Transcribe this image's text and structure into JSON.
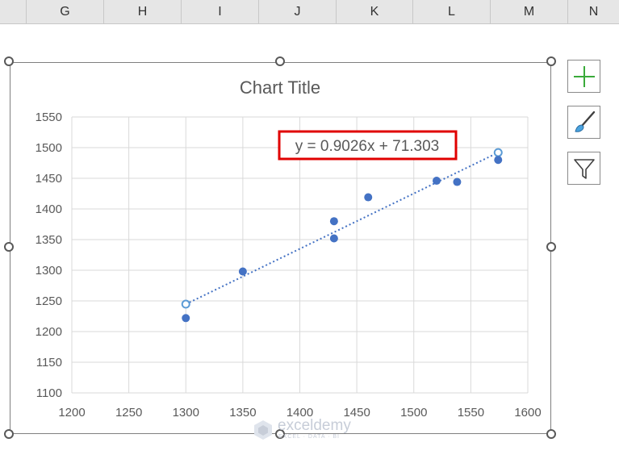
{
  "columns": [
    {
      "label": "G"
    },
    {
      "label": "H"
    },
    {
      "label": "I"
    },
    {
      "label": "J"
    },
    {
      "label": "K"
    },
    {
      "label": "L"
    },
    {
      "label": "M"
    },
    {
      "label": "N"
    }
  ],
  "chart_buttons": {
    "elements": "chart-elements-plus-icon",
    "styles": "chart-styles-brush-icon",
    "filters": "chart-filters-funnel-icon"
  },
  "watermark": {
    "name": "exceldemy",
    "tagline": "EXCEL · DATA · BI"
  },
  "colors": {
    "marker": "#4472c4",
    "trendline": "#4472c4",
    "trend_open_marker": "#5b9bd5",
    "grid": "#d9d9d9",
    "equation_border": "#e00000",
    "plus_icon": "#3aaa3a"
  },
  "chart_data": {
    "type": "scatter",
    "title": "Chart Title",
    "xlabel": "",
    "ylabel": "",
    "xlim": [
      1200,
      1600
    ],
    "ylim": [
      1100,
      1550
    ],
    "x_ticks": [
      1200,
      1250,
      1300,
      1350,
      1400,
      1450,
      1500,
      1550,
      1600
    ],
    "y_ticks": [
      1100,
      1150,
      1200,
      1250,
      1300,
      1350,
      1400,
      1450,
      1500,
      1550
    ],
    "grid": true,
    "legend": "none",
    "series": [
      {
        "points": [
          {
            "x": 1300,
            "y": 1222
          },
          {
            "x": 1350,
            "y": 1298
          },
          {
            "x": 1430,
            "y": 1380
          },
          {
            "x": 1430,
            "y": 1352
          },
          {
            "x": 1460,
            "y": 1419
          },
          {
            "x": 1520,
            "y": 1446
          },
          {
            "x": 1538,
            "y": 1444
          },
          {
            "x": 1574,
            "y": 1480
          }
        ]
      }
    ],
    "trendline": {
      "type": "linear",
      "slope": 0.9026,
      "intercept": 71.303,
      "x_start": 1300,
      "x_end": 1574,
      "equation": "y = 0.9026x + 71.303"
    }
  }
}
